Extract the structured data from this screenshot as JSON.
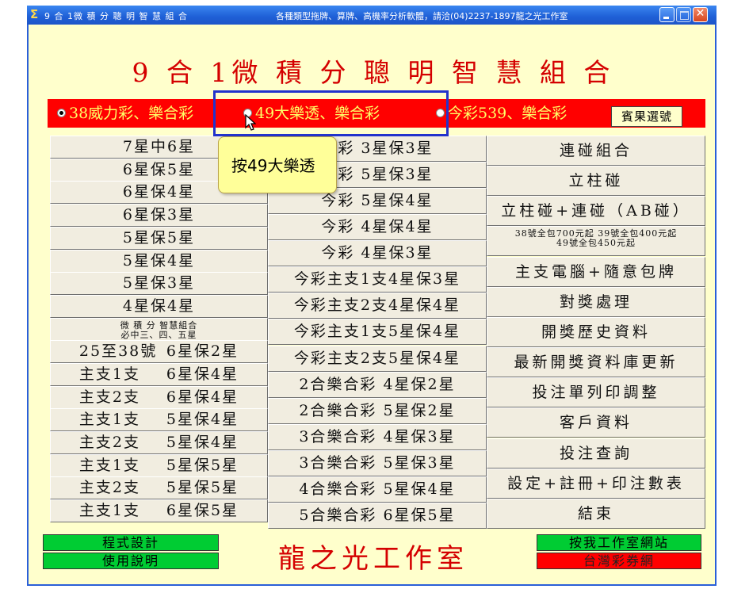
{
  "titlebar": {
    "title": "9 合 1微 積 分 聰 明 智 慧 組 合",
    "center": "各種類型拖牌、算牌、高機率分析軟體，請洽(04)2237-1897龍之光工作室",
    "close_glyph": "✕"
  },
  "main_title": "9 合 1微 積 分 聰 明 智 慧 組 合",
  "radio": {
    "options": [
      {
        "label": "38威力彩、樂合彩",
        "selected": true
      },
      {
        "label": "49大樂透、樂合彩",
        "selected": false
      },
      {
        "label": "今彩539、樂合彩",
        "selected": false
      }
    ],
    "pick_button": "賓果選號"
  },
  "tooltip": "按49大樂透",
  "column1": [
    "7星中6星",
    "6星保5星",
    "6星保4星",
    "6星保3星",
    "5星保5星",
    "5星保4星",
    "5星保3星",
    "4星保4星"
  ],
  "column1_small": [
    "微 積 分 智慧組合",
    "必中三、四、五星"
  ],
  "column1_pairs": [
    [
      "25至38號",
      "6星保2星"
    ],
    [
      "主支1支",
      "6星保4星"
    ],
    [
      "主支2支",
      "6星保4星"
    ],
    [
      "主支1支",
      "5星保4星"
    ],
    [
      "主支2支",
      "5星保4星"
    ],
    [
      "主支1支",
      "5星保5星"
    ],
    [
      "主支2支",
      "5星保5星"
    ],
    [
      "主支1支",
      "6星保5星"
    ]
  ],
  "column2": [
    "今彩 3星保3星",
    "今彩 5星保3星",
    "今彩 5星保4星",
    "今彩 4星保4星",
    "今彩 4星保3星",
    "今彩主支1支4星保3星",
    "今彩主支2支4星保4星",
    "今彩主支1支5星保4星",
    "今彩主支2支5星保4星",
    "2合樂合彩  4星保2星",
    "2合樂合彩  5星保2星",
    "3合樂合彩  4星保3星",
    "3合樂合彩  5星保3星",
    "4合樂合彩  5星保4星",
    "5合樂合彩  6星保5星"
  ],
  "column3": [
    "連碰組合",
    "立柱碰",
    "立柱碰+連碰（AB碰）",
    "主支電腦+隨意包牌",
    "對獎處理",
    "開獎歷史資料",
    "最新開獎資料庫更新",
    "投注單列印調整",
    "客戶資料",
    "投注查詢",
    "設定+註冊+印注數表",
    "結束"
  ],
  "column3_small": [
    "38號全包700元起 39號全包400元起",
    "49號全包450元起"
  ],
  "footer": {
    "program_design": "程式設計",
    "usage": "使用說明",
    "studio": "龍之光工作室",
    "website": "按我工作室網站",
    "lottery_net": "台灣彩券網"
  },
  "colors": {
    "background": "#ffffcc",
    "title_red": "#d40000",
    "radio_bar": "#ff0000",
    "radio_text": "#ffff66",
    "green_button": "#00cc33",
    "highlight_blue": "#2233cc",
    "tooltip": "#ffff99"
  }
}
